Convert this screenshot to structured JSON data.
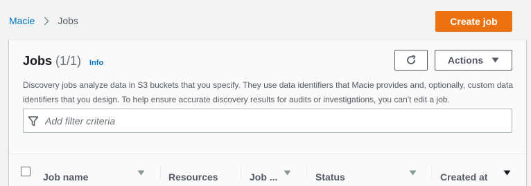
{
  "breadcrumb": {
    "root": "Macie",
    "current": "Jobs"
  },
  "header": {
    "create_button": "Create job"
  },
  "panel": {
    "title": "Jobs",
    "count": "(1/1)",
    "info": "Info",
    "actions_label": "Actions",
    "description": "Discovery jobs analyze data in S3 buckets that you specify. They use data identifiers that Macie provides and, optionally, custom data identifiers that you design. To help ensure accurate discovery results for audits or investigations, you can't edit a job.",
    "filter_placeholder": "Add filter criteria"
  },
  "table": {
    "columns": [
      {
        "label": "Job name",
        "sort": "unsorted"
      },
      {
        "label": "Resources",
        "sort": "none"
      },
      {
        "label": "Job ...",
        "sort": "unsorted"
      },
      {
        "label": "Status",
        "sort": "unsorted"
      },
      {
        "label": "Created at",
        "sort": "descending"
      }
    ]
  },
  "colors": {
    "accent": "#ec7211",
    "link": "#0073bb",
    "background": "#f2f3f3",
    "panel": "#fafafa"
  },
  "icons": {
    "breadcrumb_separator": "chevron-right-icon",
    "refresh": "refresh-icon",
    "actions_caret": "caret-down-icon",
    "filter": "filter-icon",
    "sort_unsorted": "sort-caret-down-icon",
    "sort_descending": "sort-descending-icon"
  }
}
